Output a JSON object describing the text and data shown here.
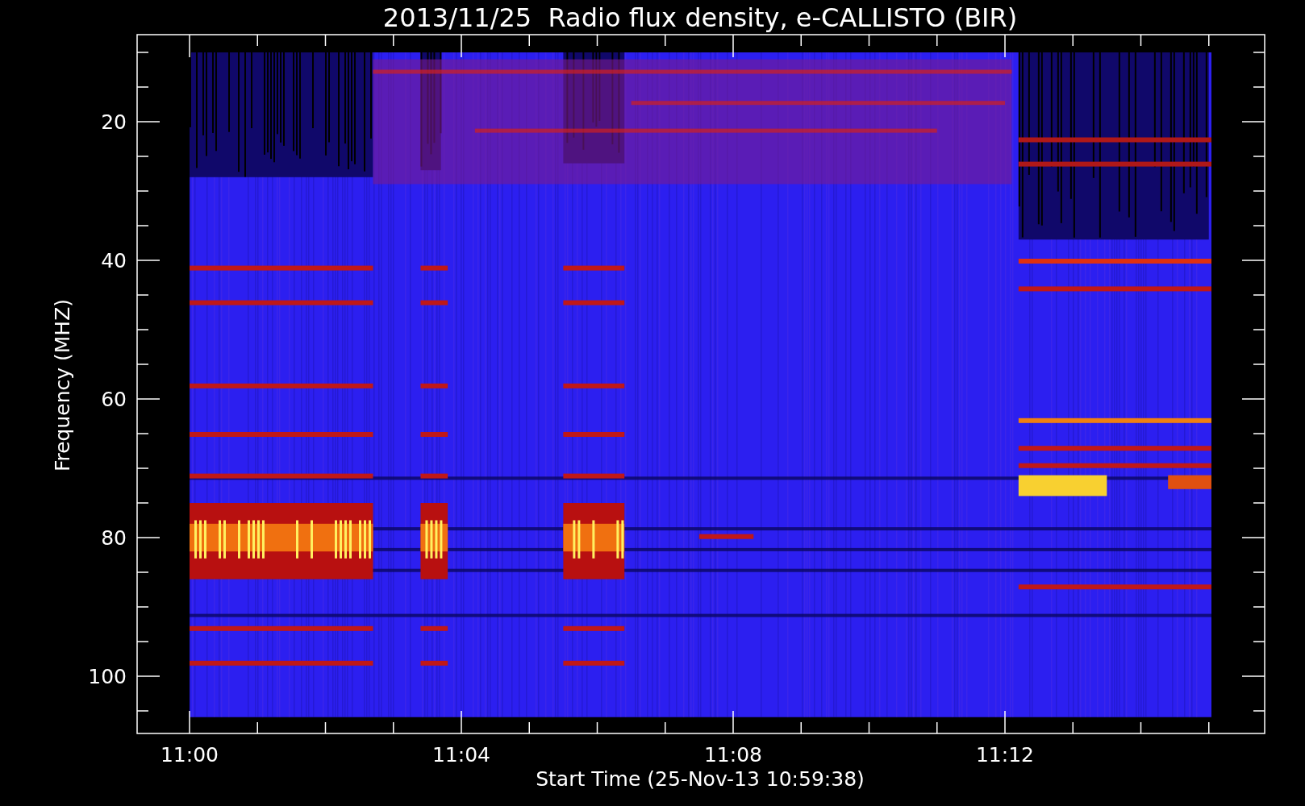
{
  "title": "2013/11/25  Radio flux density, e-CALLISTO (BIR)",
  "y_axis": {
    "label": "Frequency (MHZ)",
    "ticks": [
      "20",
      "40",
      "60",
      "80",
      "100"
    ]
  },
  "x_axis": {
    "label": "Start Time (25-Nov-13 10:59:38)",
    "ticks": [
      "11:00",
      "11:04",
      "11:08",
      "11:12"
    ]
  }
}
